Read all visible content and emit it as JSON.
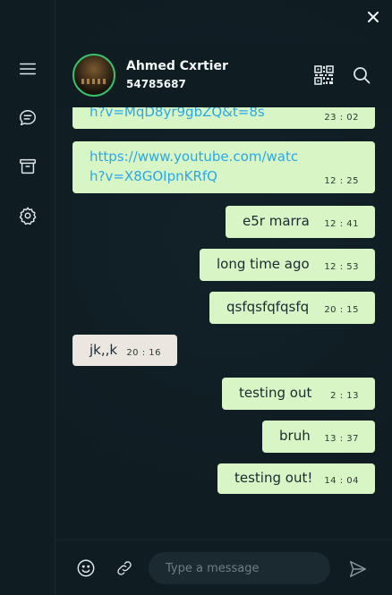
{
  "sidebar": {
    "items": [
      {
        "icon": "menu-icon"
      },
      {
        "icon": "chat-icon"
      },
      {
        "icon": "archive-icon"
      },
      {
        "icon": "settings-icon"
      }
    ]
  },
  "header": {
    "name": "Ahmed Cxrtier",
    "phone": "54785687"
  },
  "messages": [
    {
      "type": "out",
      "text": "h?v=MqD8yr9gbZQ&t=8s",
      "time": "23 : 02"
    },
    {
      "type": "out",
      "text": "https://www.youtube.com/watch?v=X8GOIpnKRfQ",
      "time": "12 : 25"
    },
    {
      "type": "out",
      "text": "e5r marra",
      "time": "12 : 41"
    },
    {
      "type": "out",
      "text": "long time ago",
      "time": "12 : 53"
    },
    {
      "type": "out",
      "text": "qsfqsfqfqsfq",
      "time": "20 : 15"
    },
    {
      "type": "in",
      "text": "jk,,k",
      "time": "20 : 16"
    },
    {
      "type": "out",
      "text": "testing out",
      "time": "2 : 13"
    },
    {
      "type": "out",
      "text": "bruh",
      "time": "13 : 37"
    },
    {
      "type": "out",
      "text": "testing out!",
      "time": "14 : 04"
    }
  ],
  "composer": {
    "placeholder": "Type a message"
  },
  "colors": {
    "background": "#0f1c22",
    "outgoing_bubble": "#d8f5c6",
    "incoming_bubble": "#ece6e1",
    "link": "#2da7e6",
    "avatar_ring": "#38c06a"
  }
}
